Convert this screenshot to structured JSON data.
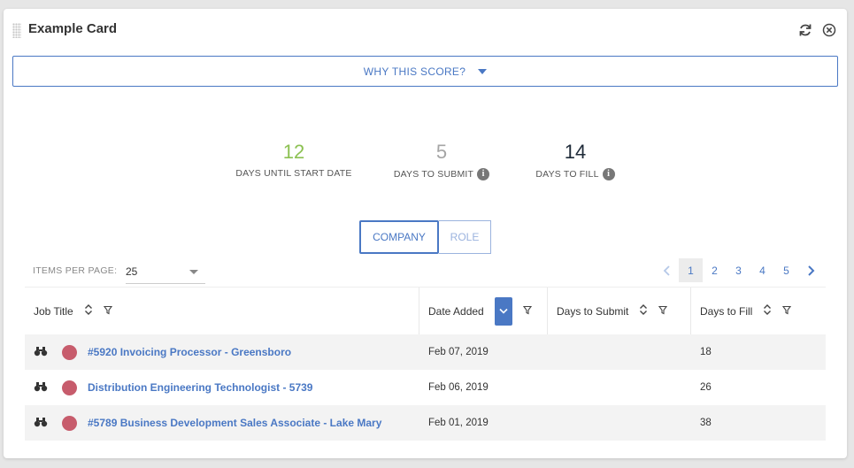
{
  "card": {
    "title": "Example Card"
  },
  "why_button": {
    "label": "WHY THIS SCORE?"
  },
  "stats": [
    {
      "value": "12",
      "label": "DAYS UNTIL START DATE",
      "color": "#8cc152",
      "info": false
    },
    {
      "value": "5",
      "label": "DAYS TO SUBMIT",
      "color": "#a5a5a5",
      "info": true
    },
    {
      "value": "14",
      "label": "DAYS TO FILL",
      "color": "#1e2a38",
      "info": true
    }
  ],
  "toggle": {
    "company": "COMPANY",
    "role": "ROLE",
    "active": "COMPANY"
  },
  "items_per_page": {
    "label": "ITEMS PER PAGE:",
    "value": "25"
  },
  "pager": {
    "pages": [
      "1",
      "2",
      "3",
      "4",
      "5"
    ],
    "active": "1"
  },
  "table": {
    "columns": [
      "Job Title",
      "Date Added",
      "Days to Submit",
      "Days to Fill"
    ],
    "rows": [
      {
        "title": "#5920 Invoicing Processor - Greensboro",
        "date": "Feb 07, 2019",
        "submit": "",
        "fill": "18",
        "status_color": "#c75c6c"
      },
      {
        "title": "Distribution Engineering Technologist - 5739",
        "date": "Feb 06, 2019",
        "submit": "",
        "fill": "26",
        "status_color": "#c75c6c"
      },
      {
        "title": "#5789 Business Development Sales Associate - Lake Mary",
        "date": "Feb 01, 2019",
        "submit": "",
        "fill": "38",
        "status_color": "#c75c6c"
      }
    ]
  },
  "colors": {
    "accent": "#4a78c4"
  }
}
